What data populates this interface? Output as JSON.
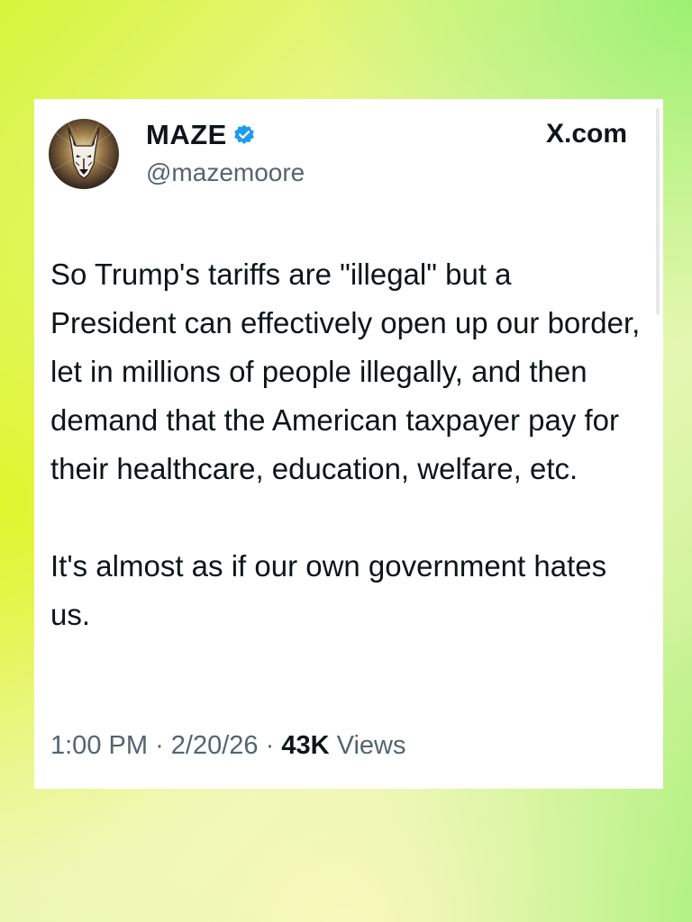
{
  "tweet": {
    "author_name": "MAZE",
    "handle": "@mazemoore",
    "source": "X.com",
    "paragraphs": [
      "So Trump's tariffs are \"illegal\" but a President can effectively open up our border, let in millions of people illegally, and then demand that the American taxpayer pay for their healthcare, education, welfare, etc.",
      "It's almost as if our own government hates us."
    ],
    "time": "1:00 PM",
    "separator": "·",
    "date": "2/20/26",
    "views_count": "43K",
    "views_label": "Views"
  },
  "icons": {
    "avatar": "dog-head-avatar",
    "verified": "verified-badge-icon"
  },
  "colors": {
    "verified_blue": "#1d9bf0",
    "text_primary": "#0f1419",
    "text_secondary": "#536471"
  }
}
